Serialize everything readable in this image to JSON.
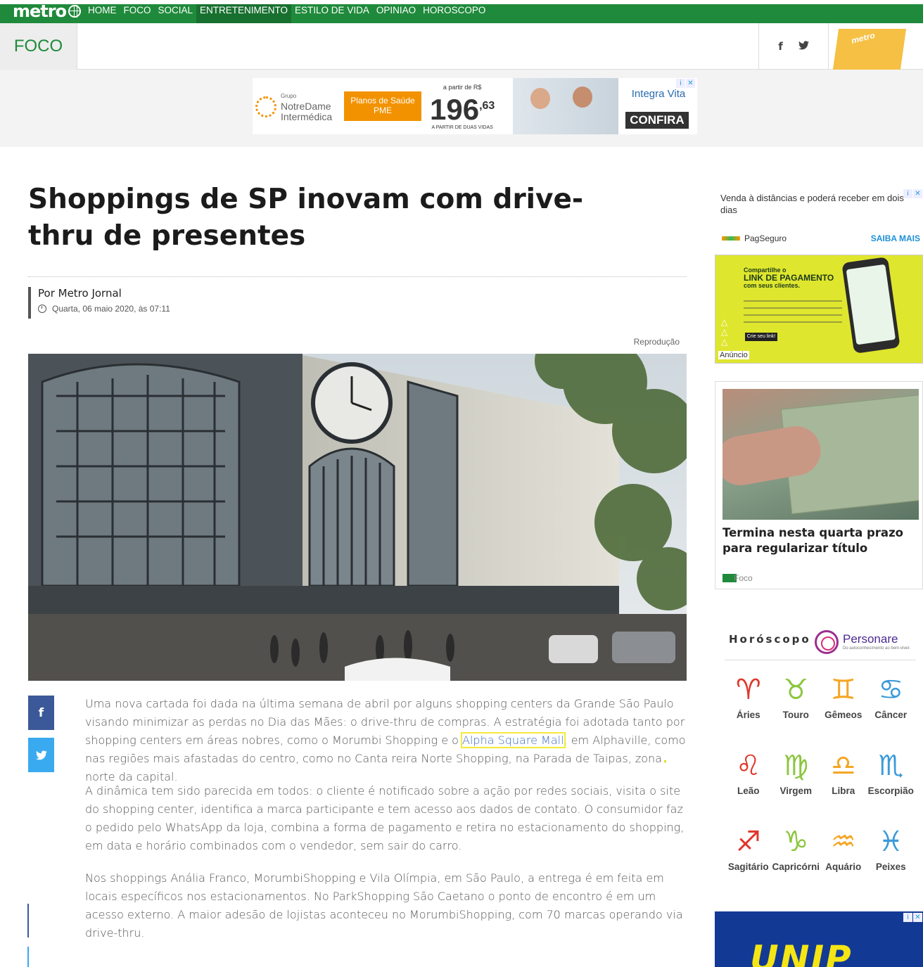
{
  "header": {
    "logo": "metro",
    "nav": [
      "HOME",
      "FOCO",
      "SOCIAL",
      "ENTRETENIMENTO",
      "ESTILO DE VIDA",
      "OPINIAO",
      "HOROSCOPO"
    ],
    "active_nav_index": 3,
    "section": "FOCO",
    "promo_label": "metro"
  },
  "top_ad": {
    "brand_small": "Grupo",
    "brand": "NotreDame Intermédica",
    "plan": "Planos de Saúde PME",
    "price_prefix": "a partir de R$",
    "price_int": "196",
    "price_dec": ",63",
    "price_suffix": "A PARTIR DE DUAS VIDAS",
    "advertiser": "Integra Vita",
    "cta": "CONFIRA"
  },
  "article": {
    "title": "Shoppings de SP inovam com drive-thru de presentes",
    "author": "Por Metro Jornal",
    "date": "Quarta, 06 maio 2020, às 07:11",
    "photo_credit": "Reprodução",
    "p1_a": "Uma nova cartada foi dada na última semana de abril por alguns shopping centers da Grande São Paulo visando minimizar as perdas no Dia das Mães: o drive-thru de compras. A estratégia foi adotada tanto por shopping centers em áreas nobres, como o Morumbi Shopping e o ",
    "p1_link": "Alpha Square Mall",
    "p1_b": ", em Alphaville, como nas regiões mais afastadas do centro, como no Canta reira Norte Shopping, na Parada de Taipas, zona norte da capital.",
    "p2": "A dinâmica tem sido parecida em todos: o cliente é notificado sobre a ação por redes sociais, visita o site do shopping center, identifica a marca participante e tem acesso aos dados de contato. O consumidor faz o pedido pelo WhatsApp da loja, combina a forma de pagamento e retira no estacionamento do shopping, em data e horário combinados com o vendedor, sem sair do carro.",
    "p3": "Nos shoppings Anália Franco, MorumbiShopping e Vila Olímpia, em São Paulo, a entrega é em feita em locais específicos nos estacionamentos. No ParkShopping São Caetano o ponto de encontro é em um acesso externo. A maior adesão de lojistas aconteceu no MorumbiShopping, com 70 marcas operando via drive-thru."
  },
  "share": {
    "facebook": "f",
    "twitter": "t"
  },
  "sidebar": {
    "ad1_text": "Venda à distâncias e poderá receber em dois dias",
    "ad1_brand": "PagSeguro",
    "ad1_cta": "SAIBA MAIS",
    "ad2_line1": "Compartilhe o",
    "ad2_line2": "LINK DE PAGAMENTO",
    "ad2_line3": "com seus clientes.",
    "ad2_button": "Crie seu link!",
    "ad2_label": "Anúncio",
    "card_title": "Termina nesta quarta prazo para regularizar título",
    "card_tag": "Foco",
    "horoscope_title": "Horóscopo",
    "horoscope_brand": "Personare",
    "horoscope_sub": "Do autoconhecimento ao bem-viver.",
    "signs": [
      {
        "name": "Áries",
        "glyph": "♈",
        "color": "#e0362b"
      },
      {
        "name": "Touro",
        "glyph": "♉",
        "color": "#8cc63f"
      },
      {
        "name": "Gêmeos",
        "glyph": "♊",
        "color": "#f5a623"
      },
      {
        "name": "Câncer",
        "glyph": "♋",
        "color": "#3b9ad9"
      },
      {
        "name": "Leão",
        "glyph": "♌",
        "color": "#e0362b"
      },
      {
        "name": "Virgem",
        "glyph": "♍",
        "color": "#8cc63f"
      },
      {
        "name": "Libra",
        "glyph": "♎",
        "color": "#f5a623"
      },
      {
        "name": "Escorpião",
        "glyph": "♏",
        "color": "#3b9ad9"
      },
      {
        "name": "Sagitário",
        "glyph": "♐",
        "color": "#e0362b"
      },
      {
        "name": "Capricórnio",
        "glyph": "♑",
        "color": "#8cc63f"
      },
      {
        "name": "Aquário",
        "glyph": "♒",
        "color": "#f5a623"
      },
      {
        "name": "Peixes",
        "glyph": "♓",
        "color": "#3b9ad9"
      }
    ],
    "bottom_ad": "UNIP"
  },
  "colors": {
    "brand_green": "#1f8a3b",
    "facebook": "#3b5998",
    "twitter": "#3aaaf0"
  }
}
